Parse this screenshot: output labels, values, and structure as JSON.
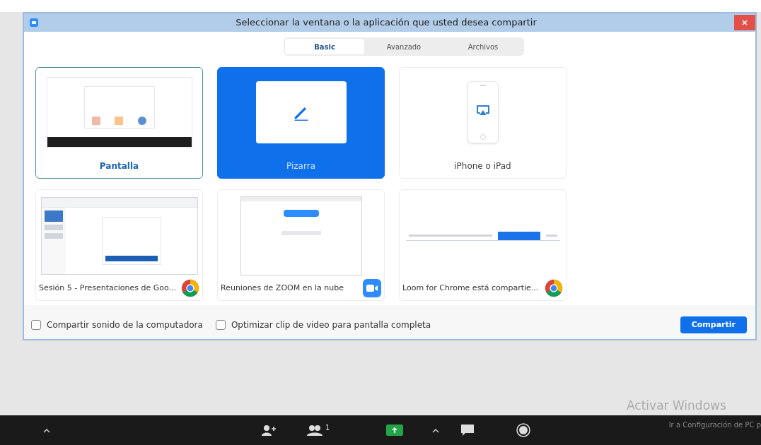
{
  "window": {
    "title": "Seleccionar la ventana o la aplicación que usted desea compartir"
  },
  "tabs": [
    {
      "label": "Basic",
      "selected": true
    },
    {
      "label": "Avanzado",
      "selected": false
    },
    {
      "label": "Archivos",
      "selected": false
    }
  ],
  "sources": [
    {
      "kind": "desktop",
      "label": "Pantalla",
      "selected": false,
      "focused": true
    },
    {
      "kind": "whiteboard",
      "label": "Pizarra",
      "selected": true,
      "focused": false
    },
    {
      "kind": "device",
      "label": "iPhone o iPad",
      "selected": false,
      "focused": false
    },
    {
      "kind": "chrome-window",
      "label": "Sesión 5 - Presentaciones de Goo...",
      "selected": false,
      "focused": false
    },
    {
      "kind": "zoom-window",
      "label": "Reuniones de ZOOM en la nube",
      "selected": false,
      "focused": false
    },
    {
      "kind": "chrome-toolbar",
      "label": "Loom for Chrome está compartie...",
      "selected": false,
      "focused": false
    }
  ],
  "options": [
    {
      "label": "Compartir sonido de la computadora",
      "checked": false
    },
    {
      "label": "Optimizar clip de video para pantalla completa",
      "checked": false
    }
  ],
  "share_button": "Compartir",
  "toolbar": {
    "participants_count": "1"
  },
  "activation_notice": {
    "title": "Activar Windows",
    "subtitle": "Ir a Configuración de PC p"
  }
}
